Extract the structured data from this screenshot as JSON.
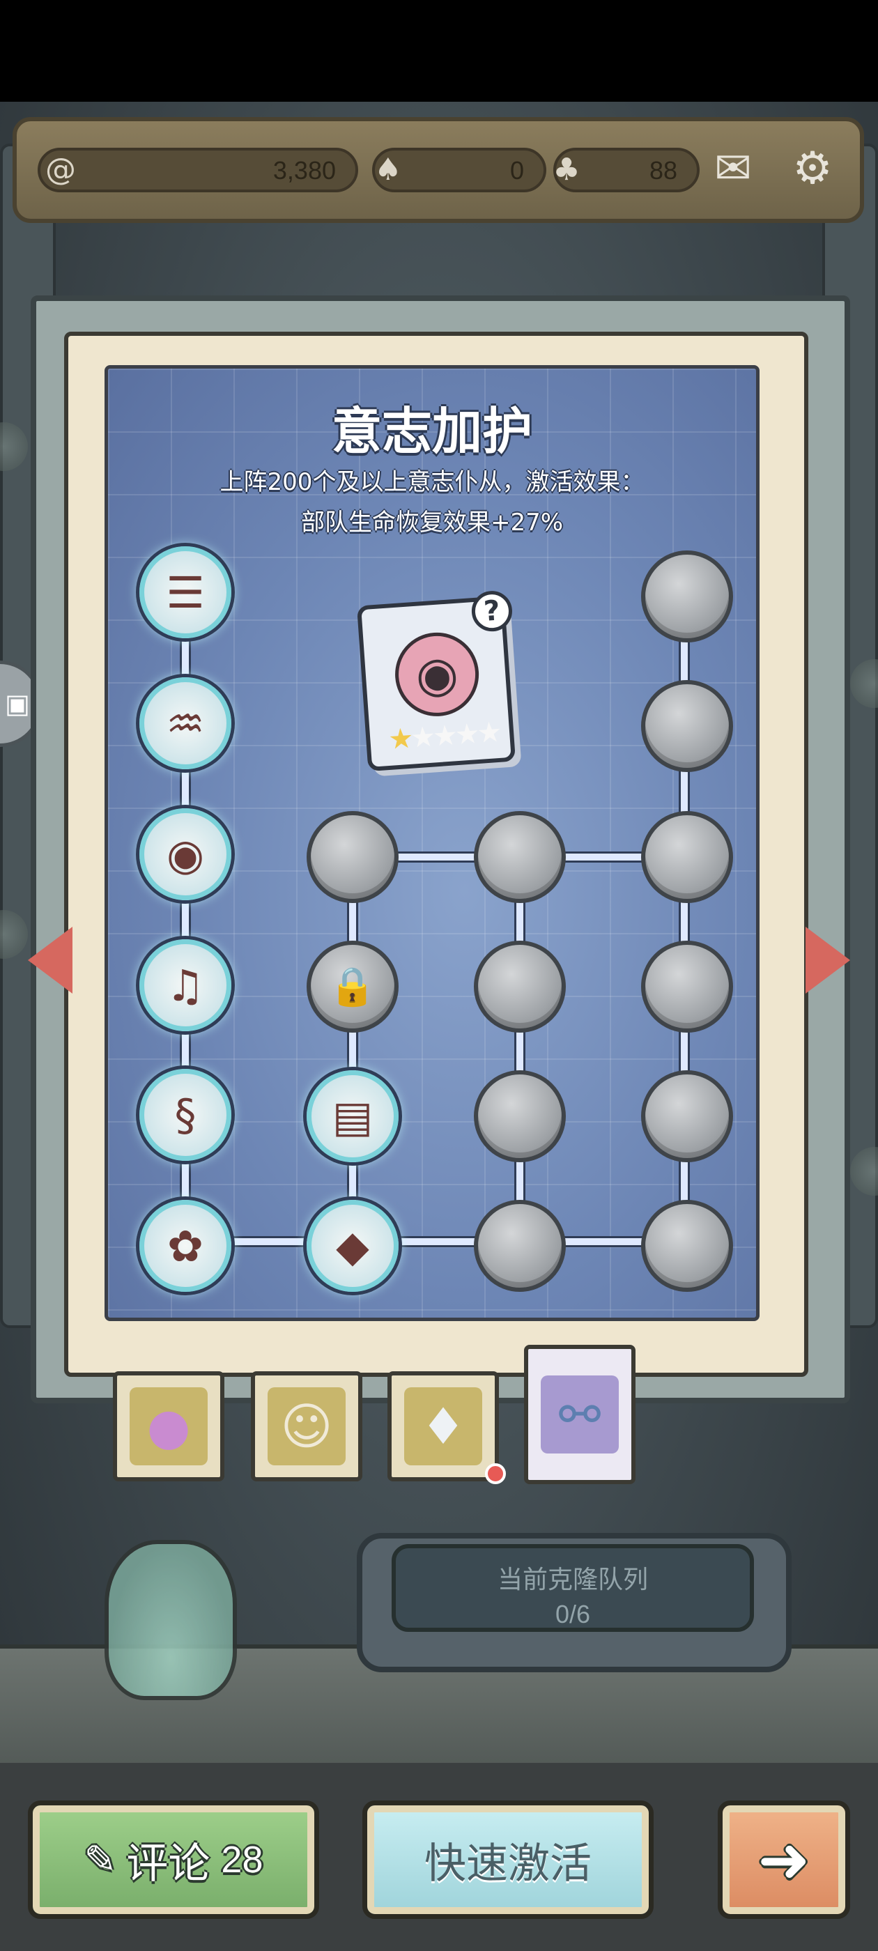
{
  "resources": {
    "coin_value": "3,380",
    "slug_value": "0",
    "slug_max": "88"
  },
  "icons": {
    "coin": "spiral-coin-icon",
    "slug": "slug-icon",
    "slug_box": "slug-box-icon",
    "mail": "mail-icon",
    "settings": "gear-icon",
    "lock": "lock-icon"
  },
  "panel": {
    "title": "意志加护",
    "description_line1": "上阵200个及以上意志仆从，激活效果：",
    "description_line2": "部队生命恢复效果+27%"
  },
  "tree": {
    "column1_active_count": 6,
    "unlocked_nodes": [
      "ribcage",
      "cloth",
      "eyeball-worm",
      "gramophone",
      "intestine",
      "flower-orb",
      "book",
      "crystal-pile"
    ],
    "locked_node": "lock"
  },
  "card": {
    "question_mark": "?",
    "stars_filled": 1,
    "stars_total": 5
  },
  "tabs": [
    {
      "name": "pacifier",
      "active": false
    },
    {
      "name": "portrait",
      "active": false
    },
    {
      "name": "uniform",
      "active": false
    },
    {
      "name": "dna-card",
      "active": true
    }
  ],
  "clone_queue": {
    "label": "当前克隆队列",
    "count": "0/6"
  },
  "buttons": {
    "comment_label": "评论",
    "comment_count": "28",
    "activate_label": "快速激活",
    "next_label": "➜"
  },
  "colors": {
    "arrow": "#d6685f",
    "active_ring": "#7ad1d9",
    "board_blue": "#6d86b5"
  }
}
